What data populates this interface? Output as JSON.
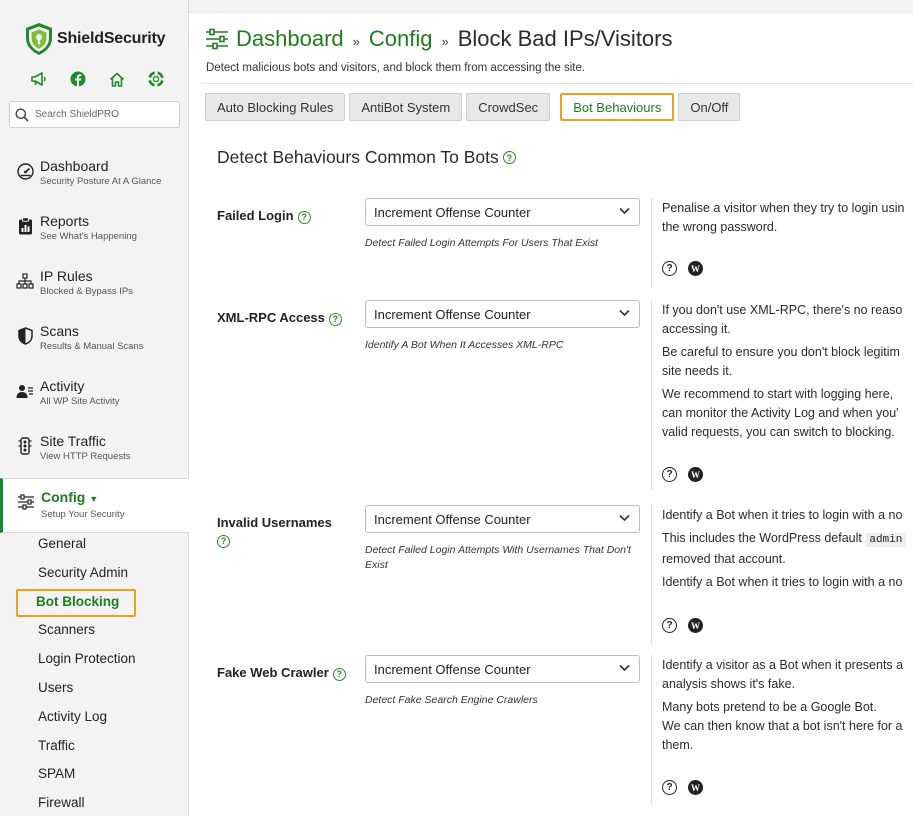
{
  "brand": {
    "name_a": "Shield",
    "name_b": "Security"
  },
  "search": {
    "placeholder": "Search ShieldPRO"
  },
  "quick_icons": [
    "megaphone-icon",
    "facebook-icon",
    "home-icon",
    "lifebuoy-icon"
  ],
  "nav": [
    {
      "title": "Dashboard",
      "sub": "Security Posture At A Glance",
      "icon": "gauge-icon"
    },
    {
      "title": "Reports",
      "sub": "See What's Happening",
      "icon": "clipboard-icon"
    },
    {
      "title": "IP Rules",
      "sub": "Blocked & Bypass IPs",
      "icon": "network-icon"
    },
    {
      "title": "Scans",
      "sub": "Results & Manual Scans",
      "icon": "shield-icon"
    },
    {
      "title": "Activity",
      "sub": "All WP Site Activity",
      "icon": "users-icon"
    },
    {
      "title": "Site Traffic",
      "sub": "View HTTP Requests",
      "icon": "traffic-light-icon"
    },
    {
      "title": "Config",
      "sub": "Setup Your Security",
      "icon": "sliders-icon"
    }
  ],
  "config_sub": [
    "General",
    "Security Admin",
    "Bot Blocking",
    "Scanners",
    "Login Protection",
    "Users",
    "Activity Log",
    "Traffic",
    "SPAM",
    "Firewall"
  ],
  "breadcrumb": {
    "a": "Dashboard",
    "b": "Config",
    "current": "Block Bad IPs/Visitors",
    "sep": "»"
  },
  "subtitle": "Detect malicious bots and visitors, and block them from accessing the site.",
  "tabs": [
    "Auto Blocking Rules",
    "AntiBot System",
    "CrowdSec",
    "Bot Behaviours",
    "On/Off"
  ],
  "section_title": "Detect Behaviours Common To Bots",
  "rows": [
    {
      "label": "Failed Login",
      "value": "Increment Offense Counter",
      "hint": "Detect Failed Login Attempts For Users That Exist",
      "desc": [
        "Penalise a visitor when they try to login usin",
        "the wrong password."
      ]
    },
    {
      "label": "XML-RPC Access",
      "value": "Increment Offense Counter",
      "hint": "Identify A Bot When It Accesses XML-RPC",
      "desc": [
        "If you don't use XML-RPC, there's no reaso",
        "accessing it.",
        "Be careful to ensure you don't block legitim",
        "site needs it.",
        "We recommend to start with logging here,",
        "can monitor the Activity Log and when you'",
        "valid requests, you can switch to blocking."
      ]
    },
    {
      "label": "Invalid Usernames",
      "value": "Increment Offense Counter",
      "hint": "Detect Failed Login Attempts With Usernames That Don't Exist",
      "desc": [
        "Identify a Bot when it tries to login with a no",
        "This includes the WordPress default",
        "admin",
        "removed that account.",
        "Identify a Bot when it tries to login with a no"
      ]
    },
    {
      "label": "Fake Web Crawler",
      "value": "Increment Offense Counter",
      "hint": "Detect Fake Search Engine Crawlers",
      "desc": [
        "Identify a visitor as a Bot when it presents a",
        "analysis shows it's fake.",
        "Many bots pretend to be a Google Bot.",
        "We can then know that a bot isn't here for a",
        "them."
      ]
    }
  ],
  "colors": {
    "accent": "#1f7d1f",
    "highlight": "#f0a020"
  }
}
